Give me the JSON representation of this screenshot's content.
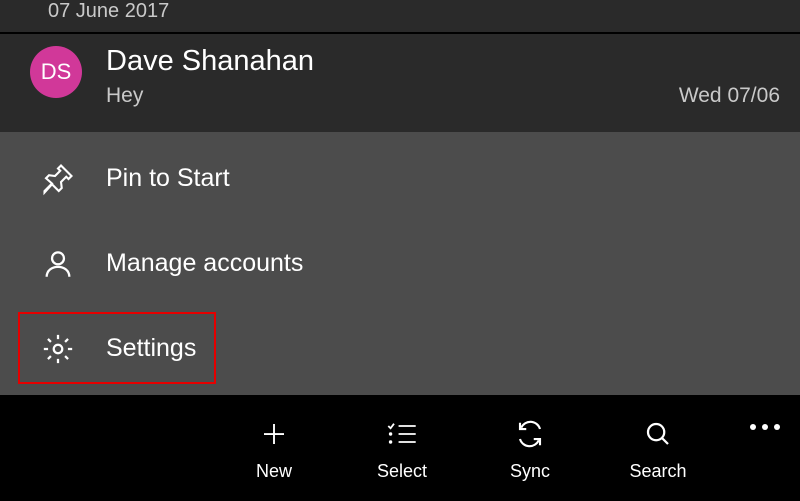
{
  "header": {
    "date_label": "07 June 2017"
  },
  "email": {
    "avatar_initials": "DS",
    "sender": "Dave Shanahan",
    "subject": "Hey",
    "timestamp": "Wed 07/06"
  },
  "menu": {
    "pin_label": "Pin to Start",
    "accounts_label": "Manage accounts",
    "settings_label": "Settings"
  },
  "toolbar": {
    "new_label": "New",
    "select_label": "Select",
    "sync_label": "Sync",
    "search_label": "Search"
  },
  "colors": {
    "avatar_bg": "#d13899",
    "highlight": "#e60000",
    "menu_bg": "#4c4c4c"
  }
}
